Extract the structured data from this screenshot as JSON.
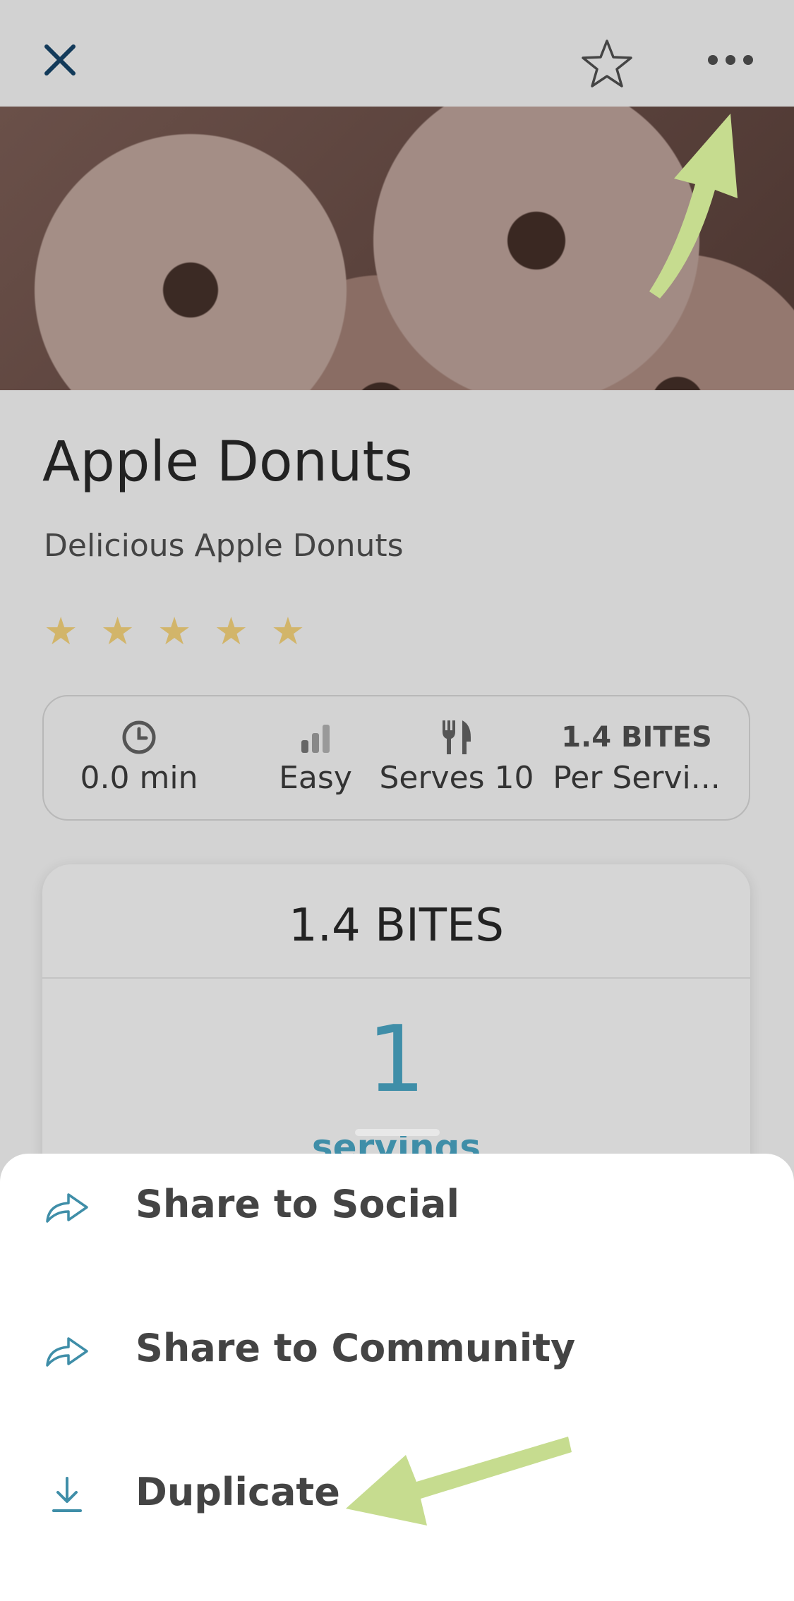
{
  "recipe": {
    "title": "Apple Donuts",
    "subtitle": "Delicious Apple Donuts",
    "rating": 5,
    "rating_max": 5
  },
  "info": {
    "time": "0.0 min",
    "difficulty": "Easy",
    "serves": "Serves 10",
    "bites_top": "1.4 BITES",
    "bites_bottom": "Per Servi..."
  },
  "bites_card": {
    "title": "1.4 BITES",
    "servings_value": "1",
    "servings_label": "servings"
  },
  "sheet": {
    "items": [
      {
        "label": "Share to Social",
        "icon": "share-icon"
      },
      {
        "label": "Share to Community",
        "icon": "share-icon"
      },
      {
        "label": "Duplicate",
        "icon": "download-icon"
      }
    ]
  },
  "colors": {
    "accent_blue": "#3f8ea8",
    "star_gold": "#d2b56a",
    "nav_dark": "#123a5a",
    "annotation_green": "#c6dc8f"
  }
}
